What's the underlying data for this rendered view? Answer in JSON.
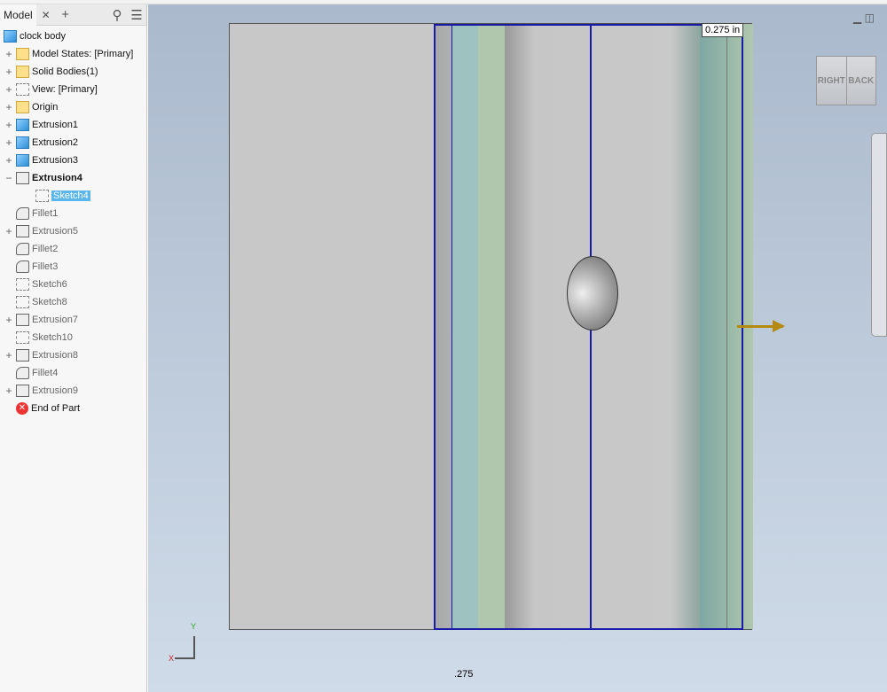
{
  "panel": {
    "tab": "Model",
    "close": "✕",
    "add": "+",
    "search": "search-icon",
    "menu": "menu-icon"
  },
  "tree": [
    {
      "label": "clock body",
      "icon": "part",
      "exp": "",
      "indent": 0
    },
    {
      "label": "Model States: [Primary]",
      "icon": "folder",
      "exp": "+",
      "indent": 1
    },
    {
      "label": "Solid Bodies(1)",
      "icon": "folder",
      "exp": "+",
      "indent": 1
    },
    {
      "label": "View: [Primary]",
      "icon": "view",
      "exp": "+",
      "indent": 1
    },
    {
      "label": "Origin",
      "icon": "folder",
      "exp": "+",
      "indent": 1
    },
    {
      "label": "Extrusion1",
      "icon": "cube",
      "exp": "+",
      "indent": 1
    },
    {
      "label": "Extrusion2",
      "icon": "cube",
      "exp": "+",
      "indent": 1
    },
    {
      "label": "Extrusion3",
      "icon": "cube",
      "exp": "+",
      "indent": 1
    },
    {
      "label": "Extrusion4",
      "icon": "wire",
      "exp": "−",
      "indent": 1,
      "bold": true
    },
    {
      "label": "Sketch4",
      "icon": "sketch",
      "exp": "",
      "indent": 2,
      "selected": true
    },
    {
      "label": "Fillet1",
      "icon": "fillet",
      "exp": "",
      "indent": 1,
      "dim": true
    },
    {
      "label": "Extrusion5",
      "icon": "wire",
      "exp": "+",
      "indent": 1,
      "dim": true
    },
    {
      "label": "Fillet2",
      "icon": "fillet",
      "exp": "",
      "indent": 1,
      "dim": true
    },
    {
      "label": "Fillet3",
      "icon": "fillet",
      "exp": "",
      "indent": 1,
      "dim": true
    },
    {
      "label": "Sketch6",
      "icon": "sketch",
      "exp": "",
      "indent": 1,
      "dim": true
    },
    {
      "label": "Sketch8",
      "icon": "sketch",
      "exp": "",
      "indent": 1,
      "dim": true
    },
    {
      "label": "Extrusion7",
      "icon": "wire",
      "exp": "+",
      "indent": 1,
      "dim": true
    },
    {
      "label": "Sketch10",
      "icon": "sketch",
      "exp": "",
      "indent": 1,
      "dim": true
    },
    {
      "label": "Extrusion8",
      "icon": "wire",
      "exp": "+",
      "indent": 1,
      "dim": true
    },
    {
      "label": "Fillet4",
      "icon": "fillet",
      "exp": "",
      "indent": 1,
      "dim": true
    },
    {
      "label": "Extrusion9",
      "icon": "wire",
      "exp": "+",
      "indent": 1,
      "dim": true
    },
    {
      "label": "End of Part",
      "icon": "end",
      "exp": "",
      "indent": 1
    }
  ],
  "viewport": {
    "dimension_top": "0.275 in",
    "dimension_bottom": ".275",
    "viewcube_left": "RIGHT",
    "viewcube_right": "BACK",
    "axis_x": "X",
    "axis_y": "Y",
    "sketch_color": "#1a1aa8"
  }
}
